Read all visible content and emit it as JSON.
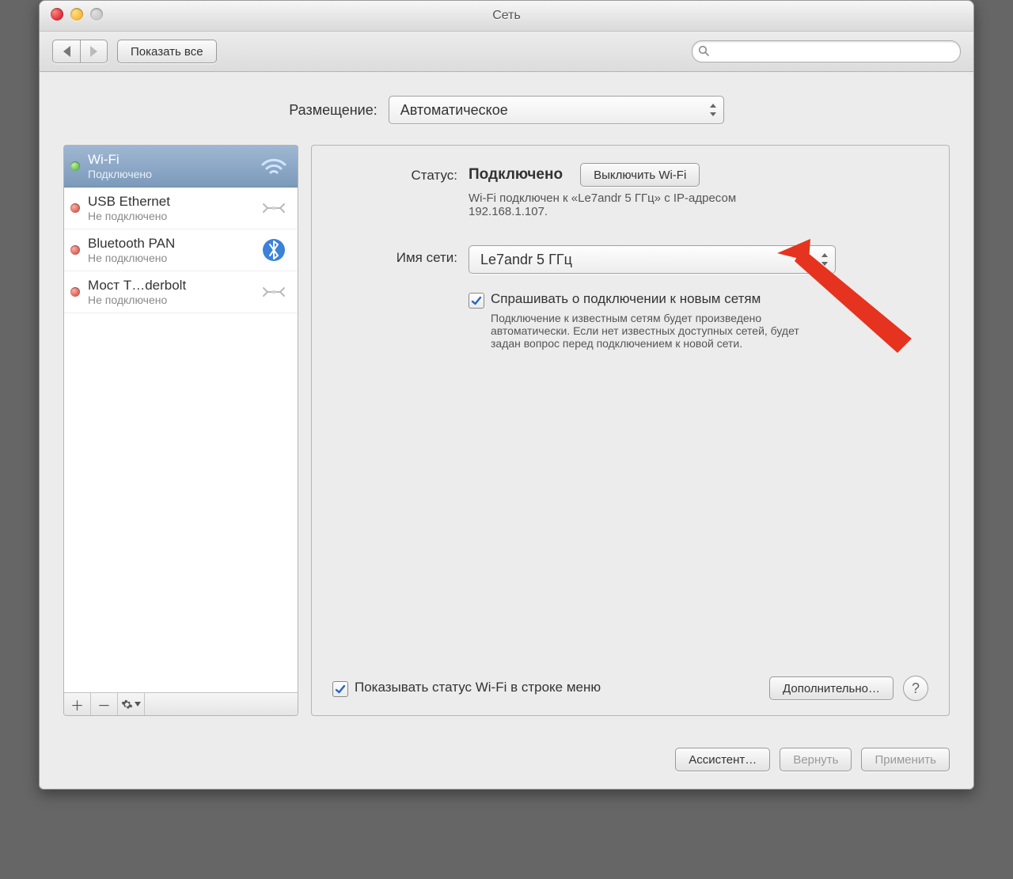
{
  "window": {
    "title": "Сеть"
  },
  "toolbar": {
    "show_all": "Показать все",
    "search_placeholder": ""
  },
  "location": {
    "label": "Размещение:",
    "value": "Автоматическое"
  },
  "sidebar": {
    "items": [
      {
        "name": "Wi-Fi",
        "sub": "Подключено",
        "status": "green",
        "icon": "wifi",
        "selected": true
      },
      {
        "name": "USB Ethernet",
        "sub": "Не подключено",
        "status": "red",
        "icon": "ethernet",
        "selected": false
      },
      {
        "name": "Bluetooth PAN",
        "sub": "Не подключено",
        "status": "red",
        "icon": "bluetooth",
        "selected": false
      },
      {
        "name": "Мост T…derbolt",
        "sub": "Не подключено",
        "status": "red",
        "icon": "ethernet",
        "selected": false
      }
    ]
  },
  "detail": {
    "status_label": "Статус:",
    "status_value": "Подключено",
    "wifi_off": "Выключить Wi-Fi",
    "status_desc": "Wi-Fi подключен к «Le7andr 5 ГГц» с IP-адресом 192.168.1.107.",
    "net_label": "Имя сети:",
    "net_value": "Le7andr 5 ГГц",
    "ask_label": "Спрашивать о подключении к новым сетям",
    "ask_desc": "Подключение к известным сетям будет произведено автоматически. Если нет известных доступных сетей, будет задан вопрос перед подключением к новой сети.",
    "show_menu": "Показывать статус Wi-Fi в строке меню",
    "advanced": "Дополнительно…"
  },
  "footer": {
    "assist": "Ассистент…",
    "revert": "Вернуть",
    "apply": "Применить"
  }
}
